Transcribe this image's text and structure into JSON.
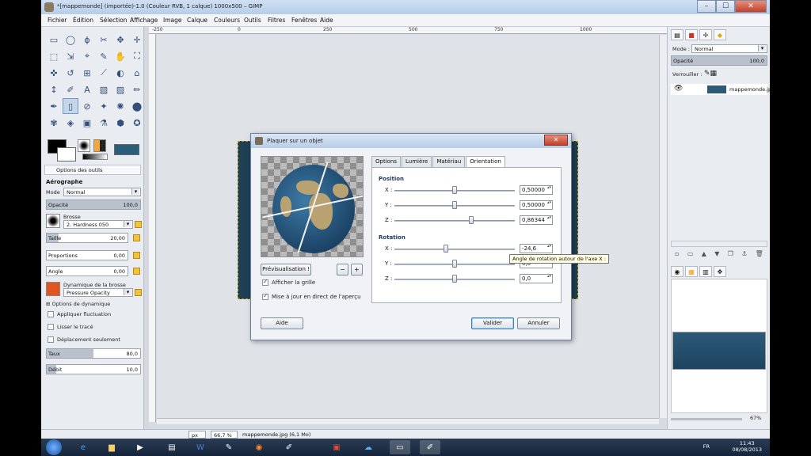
{
  "window": {
    "title": "*[mappemonde] (importée)-1.0 (Couleur RVB, 1 calque) 1000x500 – GIMP",
    "min": "–",
    "max": "☐",
    "close": "✕"
  },
  "menu": [
    "Fichier",
    "Édition",
    "Sélection",
    "Affichage",
    "Image",
    "Calque",
    "Couleurs",
    "Outils",
    "Filtres",
    "Fenêtres",
    "Aide"
  ],
  "toolbox": {
    "tools": [
      "▭",
      "◯",
      "ϕ",
      "✂",
      "✥",
      "✛",
      "⬚",
      "⇲",
      "⌖",
      "✎",
      "✋",
      "⛶",
      "✜",
      "↺",
      "⊞",
      "⟋",
      "◐",
      "⌂",
      "↕",
      "✐",
      "A",
      "▧",
      "▨",
      "✏",
      "✒",
      "▯",
      "⊘",
      "✦",
      "✺",
      "⬤",
      "✾",
      "◈",
      "▣",
      "⚗",
      "⬢",
      "✪"
    ],
    "active_tool_index": 25,
    "panel_title": "Options des outils",
    "tool_name": "Aérographe",
    "mode_label": "Mode",
    "mode_value": "Normal",
    "opacity_label": "Opacité",
    "opacity_value": "100,0",
    "opacity_fraction": 1.0,
    "brush_label": "Brosse",
    "brush_value": "2. Hardness 050",
    "size_label": "Taille",
    "size_value": "20,00",
    "size_fraction": 0.15,
    "proportions_label": "Proportions",
    "proportions_value": "0,00",
    "angle_label": "Angle",
    "angle_value": "0,00",
    "dynamics_label": "Dynamique de la brosse",
    "dynamics_value": "Pressure Opacity",
    "dynamics_options": "Options de dynamique",
    "apply_fluctuation": "Appliquer fluctuation",
    "smooth": "Lisser le tracé",
    "incremental": "Déplacement seulement",
    "rate_label": "Taux",
    "rate_value": "80,0",
    "rate_fraction": 0.5,
    "flow_label": "Débit",
    "flow_value": "10,0",
    "flow_fraction": 0.1
  },
  "ruler": [
    "-250",
    "0",
    "250",
    "500",
    "750",
    "1000"
  ],
  "status": {
    "unit": "px",
    "zoom": "66,7 %",
    "file": "mappemonde.jpg (6,1 Mo)"
  },
  "rightdock": {
    "mode_label": "Mode :",
    "mode_value": "Normal",
    "opacity_label": "Opacité",
    "opacity_value": "100,0",
    "lock_label": "Verrouiller :",
    "layer_name": "mappemonde.jpg",
    "zoom_percent": "67%"
  },
  "dialog": {
    "title": "Plaquer sur un objet",
    "close": "✕",
    "preview_button": "Prévisualisation !",
    "zoom_in": "+",
    "zoom_out": "−",
    "show_grid": "Afficher la grille",
    "live_update": "Mise à jour en direct de l'aperçu",
    "tabs": [
      "Options",
      "Lumière",
      "Matériau",
      "Orientation"
    ],
    "position_title": "Position",
    "rotation_title": "Rotation",
    "axes": [
      "X :",
      "Y :",
      "Z :"
    ],
    "position": [
      {
        "value": "0,50000",
        "fraction": 0.5
      },
      {
        "value": "0,50000",
        "fraction": 0.5
      },
      {
        "value": "0,86344",
        "fraction": 0.64
      }
    ],
    "rotation": [
      {
        "value": "-24,6",
        "fraction": 0.43
      },
      {
        "value": "0,0",
        "fraction": 0.5
      },
      {
        "value": "0,0",
        "fraction": 0.5
      }
    ],
    "tooltip": "Angle de rotation autour de l'axe X :",
    "help_button": "Aide",
    "ok_button": "Valider",
    "cancel_button": "Annuler"
  },
  "taskbar": {
    "language": "FR",
    "time": "11:43",
    "date": "08/08/2013"
  }
}
